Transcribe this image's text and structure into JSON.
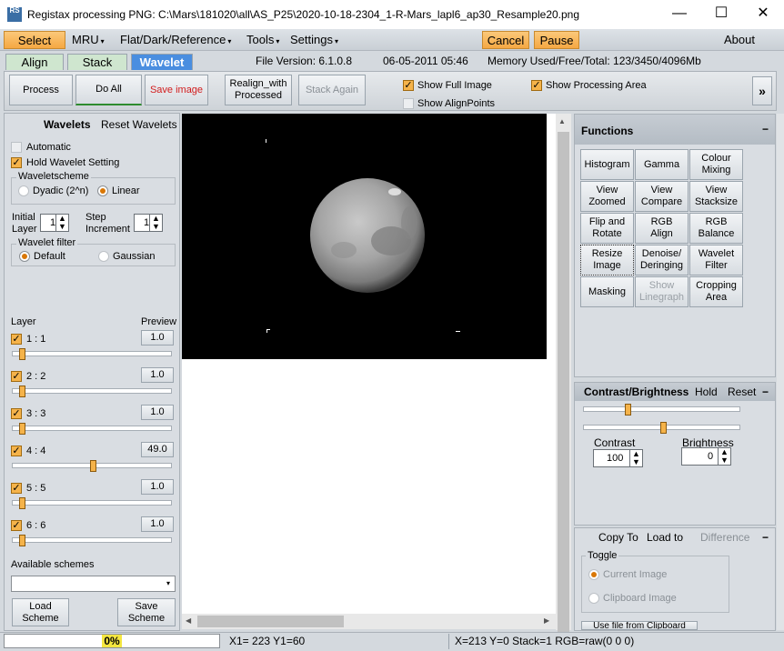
{
  "window": {
    "title": "Registax processing PNG: C:\\Mars\\181020\\all\\AS_P25\\2020-10-18-2304_1-R-Mars_lapl6_ap30_Resample20.png",
    "app_icon_text": "RS",
    "minimize": "—",
    "maximize": "☐",
    "close": "✕"
  },
  "menu": {
    "select": "Select",
    "mru": "MRU",
    "flat": "Flat/Dark/Reference",
    "tools": "Tools",
    "settings": "Settings",
    "cancel": "Cancel",
    "pause": "Pause",
    "about": "About",
    "caret": "▾"
  },
  "tabs": [
    "Align",
    "Stack",
    "Wavelet"
  ],
  "info": {
    "file_version": "File Version: 6.1.0.8",
    "date": "06-05-2011 05:46",
    "memory": "Memory Used/Free/Total: 123/3450/4096Mb"
  },
  "toolbar": {
    "process": "Process",
    "do_all": "Do All",
    "save_image": "Save image",
    "realign_line1": "Realign_with",
    "realign_line2": "Processed",
    "stack_again": "Stack Again",
    "show_full_image": "Show Full Image",
    "show_alignpoints": "Show AlignPoints",
    "show_processing_area": "Show Processing Area",
    "expand": "»"
  },
  "wavelets": {
    "title": "Wavelets",
    "reset": "Reset Wavelets",
    "automatic": "Automatic",
    "hold": "Hold Wavelet Setting",
    "scheme_title": "Waveletscheme",
    "dyadic": "Dyadic (2^n)",
    "linear": "Linear",
    "initial_layer_l1": "Initial",
    "initial_layer_l2": "Layer",
    "initial_value": "1",
    "step_l1": "Step",
    "step_l2": "Increment",
    "step_value": "1",
    "filter_title": "Wavelet filter",
    "default": "Default",
    "gaussian": "Gaussian",
    "layer_header": "Layer",
    "preview_header": "Preview",
    "layers": [
      {
        "label": "1 : 1",
        "value": "1.0",
        "slider": 0.0
      },
      {
        "label": "2 : 2",
        "value": "1.0",
        "slider": 0.0
      },
      {
        "label": "3 : 3",
        "value": "1.0",
        "slider": 0.0
      },
      {
        "label": "4 : 4",
        "value": "49.0",
        "slider": 0.5
      },
      {
        "label": "5 : 5",
        "value": "1.0",
        "slider": 0.0
      },
      {
        "label": "6 : 6",
        "value": "1.0",
        "slider": 0.0
      }
    ],
    "available_schemes": "Available schemes",
    "load_l1": "Load",
    "load_l2": "Scheme",
    "save_l1": "Save",
    "save_l2": "Scheme"
  },
  "functions": {
    "title": "Functions",
    "buttons": [
      {
        "l1": "Histogram",
        "l2": "",
        "dis": false
      },
      {
        "l1": "Gamma",
        "l2": "",
        "dis": false
      },
      {
        "l1": "Colour",
        "l2": "Mixing",
        "dis": false
      },
      {
        "l1": "View",
        "l2": "Zoomed",
        "dis": false
      },
      {
        "l1": "View",
        "l2": "Compare",
        "dis": false
      },
      {
        "l1": "View",
        "l2": "Stacksize",
        "dis": false
      },
      {
        "l1": "Flip and",
        "l2": "Rotate",
        "dis": false
      },
      {
        "l1": "RGB",
        "l2": "Align",
        "dis": false
      },
      {
        "l1": "RGB",
        "l2": "Balance",
        "dis": false
      },
      {
        "l1": "Resize",
        "l2": "Image",
        "dis": false
      },
      {
        "l1": "Denoise/",
        "l2": "Deringing",
        "dis": false
      },
      {
        "l1": "Wavelet",
        "l2": "Filter",
        "dis": false
      },
      {
        "l1": "Masking",
        "l2": "",
        "dis": false
      },
      {
        "l1": "Show",
        "l2": "Linegraph",
        "dis": true
      },
      {
        "l1": "Cropping",
        "l2": "Area",
        "dis": false
      }
    ]
  },
  "contrast": {
    "title": "Contrast/Brightness",
    "hold": "Hold",
    "reset": "Reset",
    "contrast_label": "Contrast",
    "contrast_value": "100",
    "brightness_label": "Brightness",
    "brightness_value": "0",
    "slider1": 0.25,
    "slider2": 0.5
  },
  "copy": {
    "copy_to": "Copy To",
    "load_to": "Load to",
    "difference": "Difference",
    "toggle": "Toggle",
    "current_image": "Current Image",
    "clipboard_image": "Clipboard Image",
    "use_file": "Use file from Clipboard"
  },
  "status": {
    "progress": "0%",
    "coords": "X1= 223 Y1=60",
    "pixel": "X=213 Y=0 Stack=1 RGB=raw(0 0 0)"
  }
}
